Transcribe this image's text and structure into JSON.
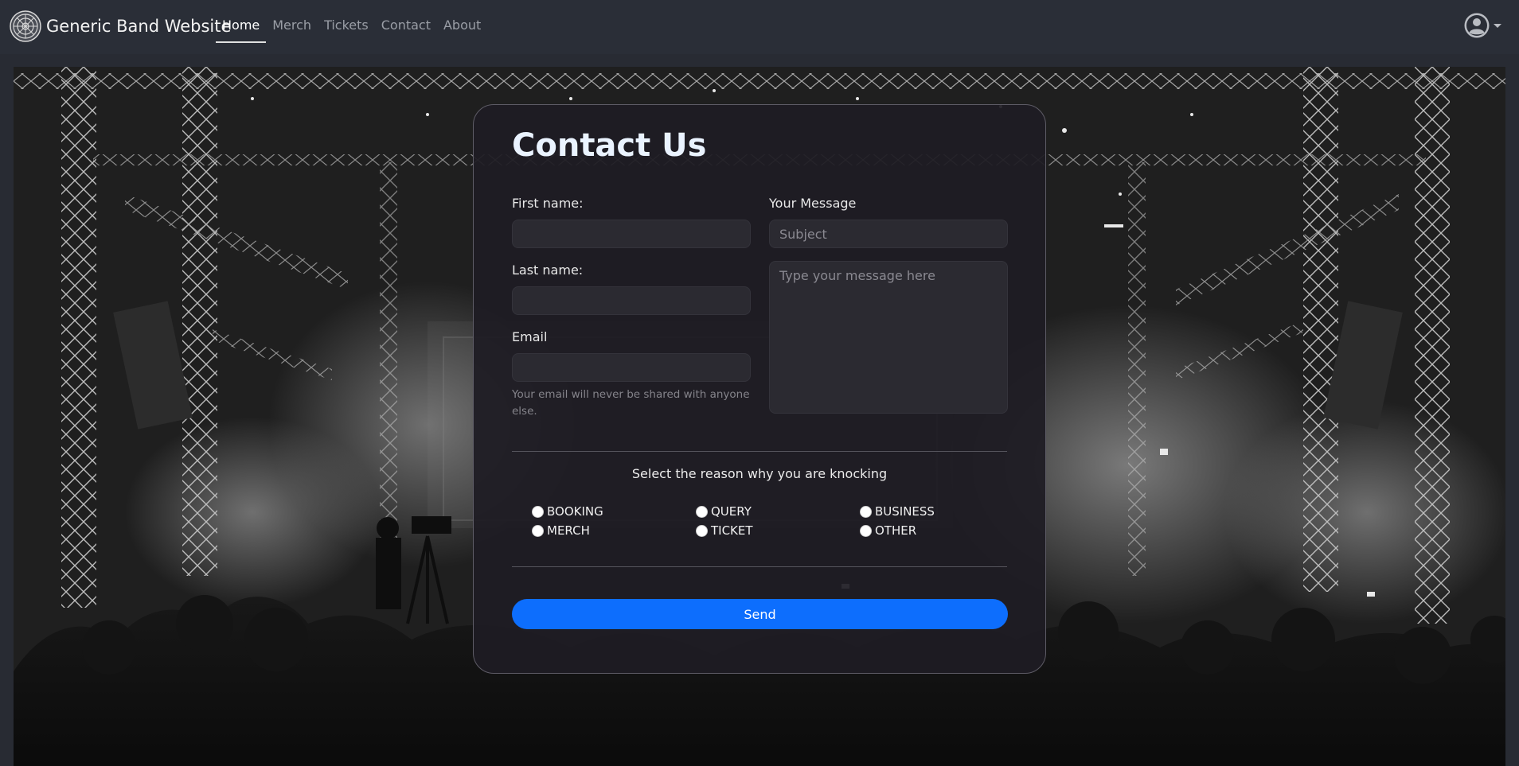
{
  "navbar": {
    "brand": "Generic Band Website",
    "links": [
      {
        "label": "Home",
        "active": true
      },
      {
        "label": "Merch",
        "active": false
      },
      {
        "label": "Tickets",
        "active": false
      },
      {
        "label": "Contact",
        "active": false
      },
      {
        "label": "About",
        "active": false
      }
    ],
    "logo_icon": "celtic-knot-logo",
    "user_icon": "user-circle-icon"
  },
  "contact": {
    "title": "Contact Us",
    "first_name_label": "First name:",
    "last_name_label": "Last name:",
    "email_label": "Email",
    "email_help": "Your email will never be shared with anyone else.",
    "message_label": "Your Message",
    "subject_placeholder": "Subject",
    "message_placeholder": "Type your message here",
    "reason_title": "Select the reason why you are knocking",
    "reasons": [
      "BOOKING",
      "QUERY",
      "BUSINESS",
      "MERCH",
      "TICKET",
      "OTHER"
    ],
    "send_label": "Send"
  },
  "colors": {
    "page_bg": "#282b33",
    "navbar_bg": "#2a2e37",
    "card_bg": "#1e1c23",
    "accent": "#0d6efd",
    "title": "#eaf3ff"
  }
}
